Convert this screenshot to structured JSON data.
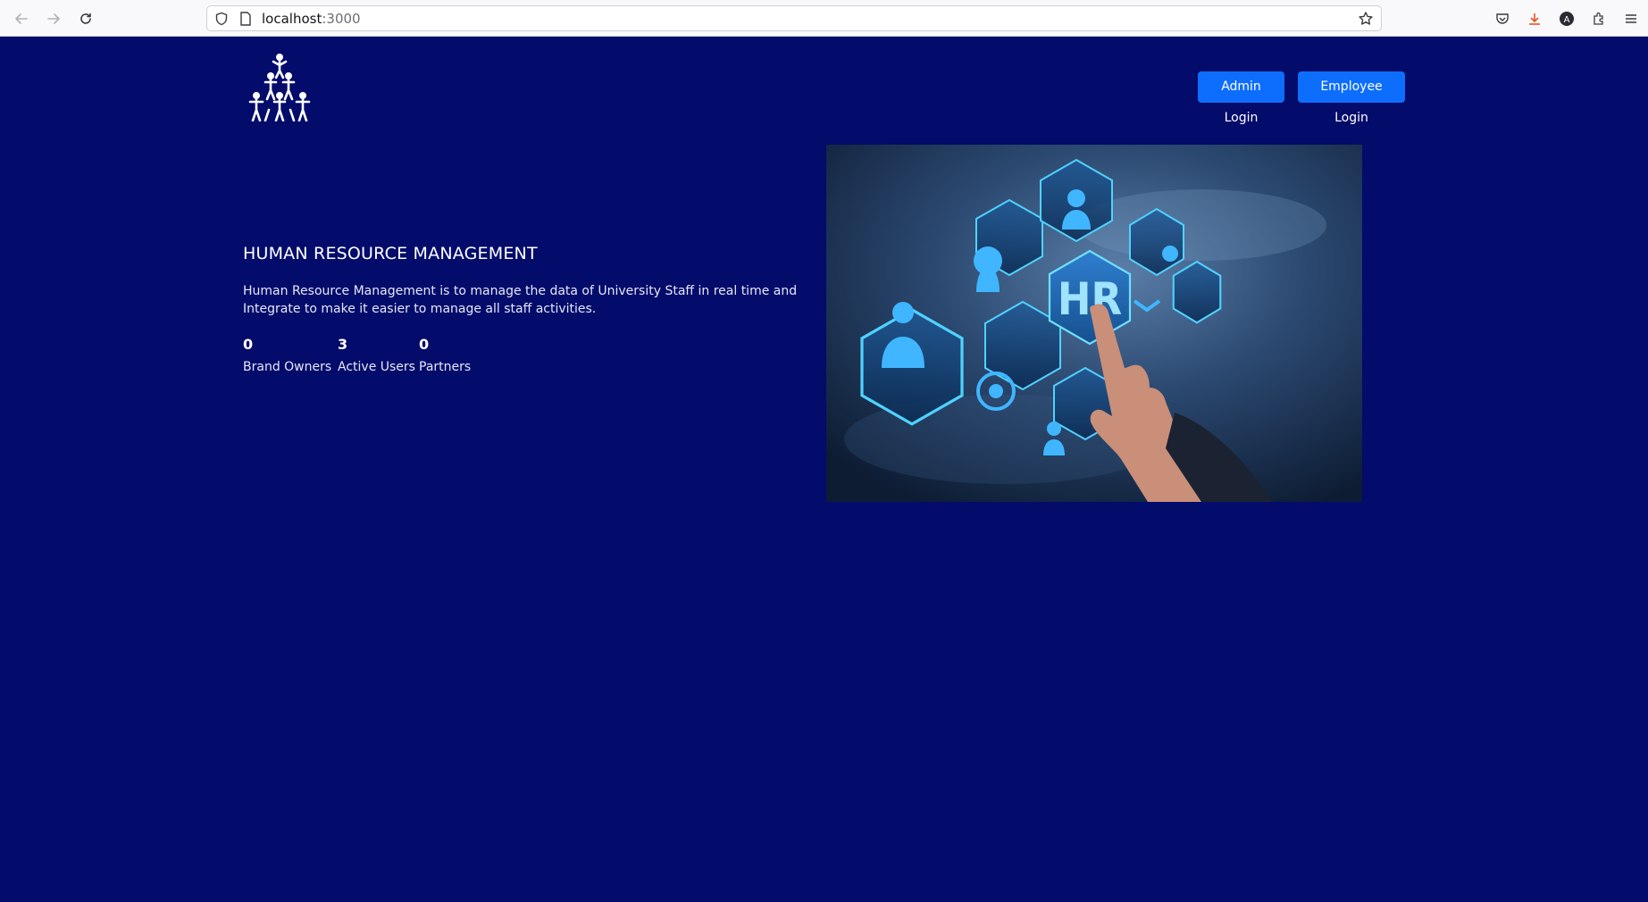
{
  "browser": {
    "url_host": "localhost",
    "url_port": ":3000"
  },
  "header": {
    "logo_icon": "people-pyramid-icon",
    "admin_login_label": "Admin Login",
    "employee_login_label": "Employee Login"
  },
  "hero": {
    "title": "HUMAN RESOURCE MANAGEMENT",
    "description": "Human Resource Management is to manage the data of University Staff in real time and Integrate to make it easier to manage all staff activities.",
    "stats": [
      {
        "value": "0",
        "label": "Brand Owners"
      },
      {
        "value": "3",
        "label": "Active Users"
      },
      {
        "value": "0",
        "label": "Partners"
      }
    ],
    "image_text": "HR"
  },
  "colors": {
    "page_background": "#030b6b",
    "button_primary": "#0d6efd",
    "text": "#ffffff"
  }
}
